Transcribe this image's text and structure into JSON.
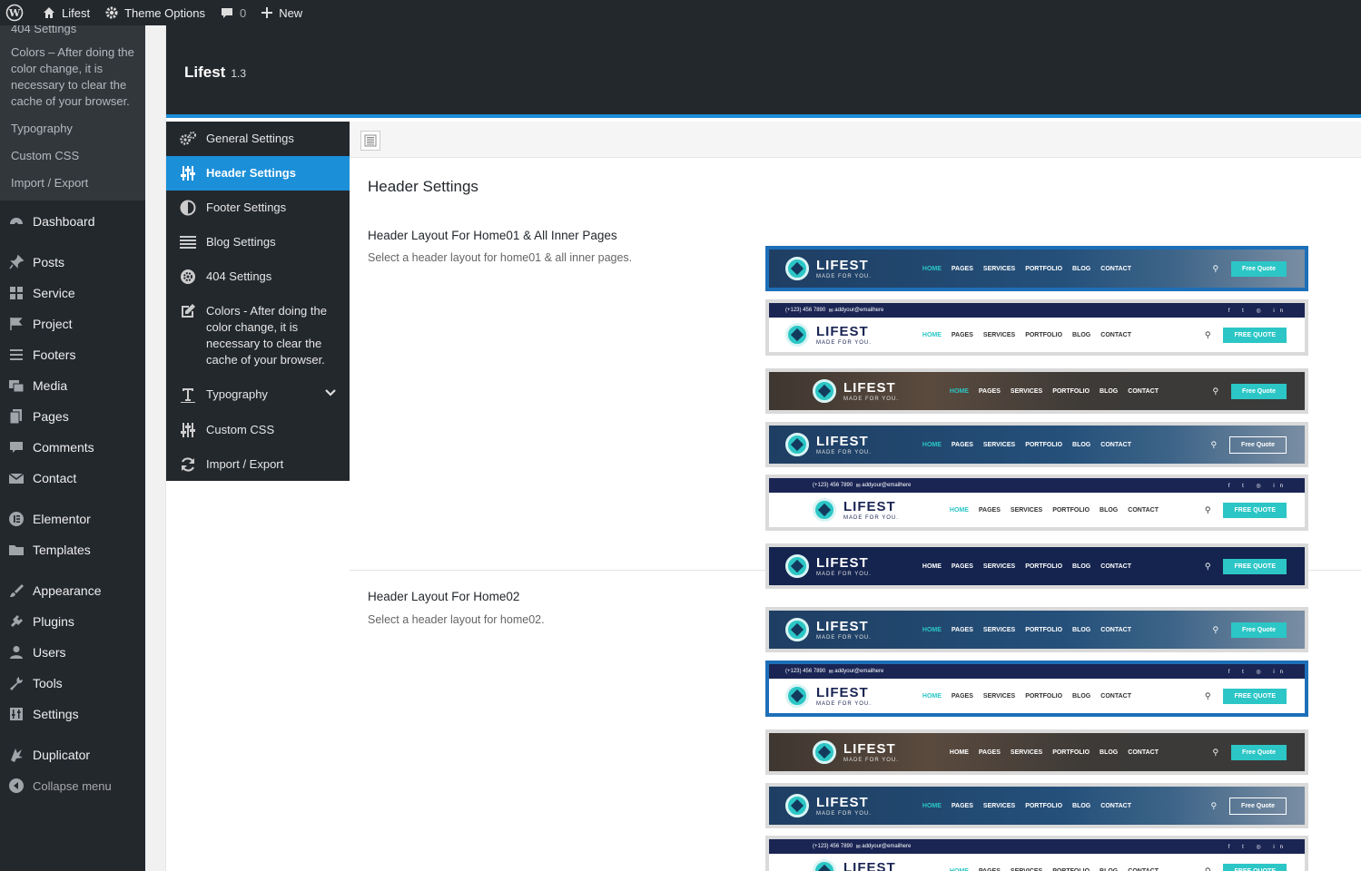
{
  "admin_bar": {
    "site_name": "Lifest",
    "theme_options": "Theme Options",
    "comments_count": "0",
    "new_label": "New"
  },
  "admin_menu": {
    "submenu": [
      {
        "label": "404 Settings"
      },
      {
        "label": "Colors – After doing the color change, it is necessary to clear the cache of your browser."
      },
      {
        "label": "Typography"
      },
      {
        "label": "Custom CSS"
      },
      {
        "label": "Import / Export"
      }
    ],
    "items": [
      {
        "label": "Dashboard",
        "icon": "dashboard-icon"
      },
      {
        "label": "Posts",
        "icon": "pin-icon"
      },
      {
        "label": "Service",
        "icon": "grid-icon"
      },
      {
        "label": "Project",
        "icon": "flag-icon"
      },
      {
        "label": "Footers",
        "icon": "list-icon"
      },
      {
        "label": "Media",
        "icon": "media-icon"
      },
      {
        "label": "Pages",
        "icon": "pages-icon"
      },
      {
        "label": "Comments",
        "icon": "comment-icon"
      },
      {
        "label": "Contact",
        "icon": "mail-icon"
      },
      {
        "label": "Elementor",
        "icon": "elementor-icon"
      },
      {
        "label": "Templates",
        "icon": "folder-icon"
      },
      {
        "label": "Appearance",
        "icon": "brush-icon"
      },
      {
        "label": "Plugins",
        "icon": "plug-icon"
      },
      {
        "label": "Users",
        "icon": "user-icon"
      },
      {
        "label": "Tools",
        "icon": "wrench-icon"
      },
      {
        "label": "Settings",
        "icon": "sliders-icon"
      },
      {
        "label": "Duplicator",
        "icon": "duplicator-icon"
      }
    ],
    "collapse_label": "Collapse menu"
  },
  "panel": {
    "title": "Lifest",
    "version": "1.3",
    "nav": [
      {
        "label": "General Settings",
        "icon": "cogs-icon"
      },
      {
        "label": "Header Settings",
        "icon": "sliders-icon"
      },
      {
        "label": "Footer Settings",
        "icon": "half-circle-icon"
      },
      {
        "label": "Blog Settings",
        "icon": "list-icon"
      },
      {
        "label": "404 Settings",
        "icon": "gear-icon"
      },
      {
        "label": "Colors - After doing the color change, it is necessary to clear the cache of your browser.",
        "icon": "edit-icon"
      },
      {
        "label": "Typography",
        "icon": "text-icon"
      },
      {
        "label": "Custom CSS",
        "icon": "sliders-icon"
      },
      {
        "label": "Import / Export",
        "icon": "refresh-icon"
      }
    ],
    "section_title": "Header Settings",
    "fields": [
      {
        "label": "Header Layout For Home01 & All Inner Pages",
        "desc": "Select a header layout for home01 & all inner pages."
      },
      {
        "label": "Header Layout For Home02",
        "desc": "Select a header layout for home02."
      }
    ]
  },
  "thumb_text": {
    "logo_name": "LIFEST",
    "logo_tag": "MADE FOR YOU.",
    "nav": [
      "HOME",
      "PAGES",
      "SERVICES",
      "PORTFOLIO",
      "BLOG",
      "CONTACT"
    ],
    "quote_title": "Free Quote",
    "quote_upper": "FREE QUOTE",
    "phone": "(+123) 456 7890",
    "email": "addyour@emailhere",
    "socials": "f  t  ◎  in"
  },
  "colors": {
    "accent_blue": "#1b8fd8",
    "teal": "#2cc6c6",
    "admin_dark": "#23282d"
  }
}
